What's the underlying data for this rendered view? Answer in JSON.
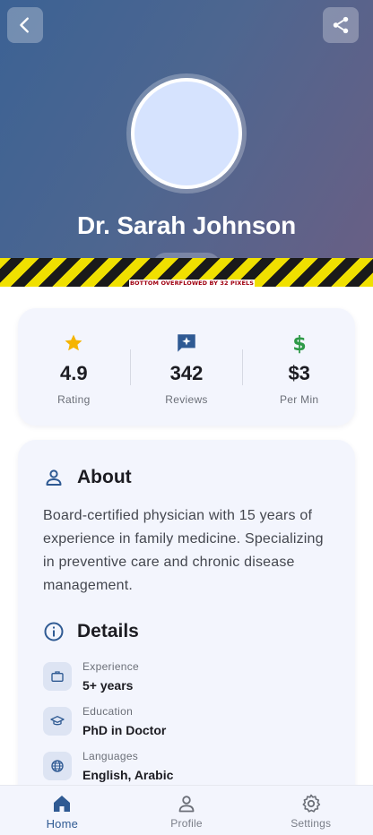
{
  "header": {
    "doctor_name": "Dr. Sarah Johnson",
    "back_icon": "back-arrow-icon",
    "share_icon": "share-icon"
  },
  "debug_banner": {
    "text": "BOTTOM OVERFLOWED BY 32 PIXELS"
  },
  "stats": [
    {
      "icon": "star-icon",
      "icon_color": "#f5b400",
      "value": "4.9",
      "label": "Rating"
    },
    {
      "icon": "reviews-icon",
      "icon_color": "#2f5a93",
      "value": "342",
      "label": "Reviews"
    },
    {
      "icon": "dollar-icon",
      "icon_color": "#2e9a47",
      "value": "$3",
      "label": "Per Min"
    }
  ],
  "about": {
    "title": "About",
    "text": "Board-certified physician with 15 years of experience in family medicine. Specializing in preventive care and chronic disease management."
  },
  "details": {
    "title": "Details",
    "items": [
      {
        "icon": "briefcase-icon",
        "label": "Experience",
        "value": "5+ years"
      },
      {
        "icon": "graduation-cap-icon",
        "label": "Education",
        "value": "PhD in Doctor"
      },
      {
        "icon": "globe-icon",
        "label": "Languages",
        "value": "English, Arabic"
      }
    ]
  },
  "nav": [
    {
      "icon": "home-icon",
      "label": "Home",
      "active": true
    },
    {
      "icon": "profile-icon",
      "label": "Profile",
      "active": false
    },
    {
      "icon": "settings-icon",
      "label": "Settings",
      "active": false
    }
  ],
  "colors": {
    "primary": "#2f5a93",
    "hero_start": "#3c6294",
    "hero_end": "#6a5f84",
    "card_bg": "#f3f5fd",
    "avatar_fill": "#d6e3fe"
  }
}
